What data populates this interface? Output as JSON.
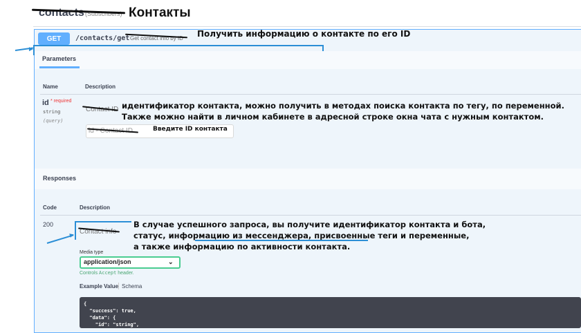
{
  "header": {
    "tag_title": "contacts",
    "tag_subtitle": "(Subscribers)",
    "tag_title_ru": "Контакты"
  },
  "operation": {
    "method": "GET",
    "path": "/contacts/get",
    "summary": "Get contact info by ID",
    "note": "Получить информацию о контакте по его ID"
  },
  "tabs": {
    "parameters": "Parameters"
  },
  "params_table": {
    "col_name": "Name",
    "col_description": "Description",
    "param": {
      "name": "id",
      "required_mark": "*",
      "required_label": "required",
      "type": "string",
      "in": "(query)",
      "description": "Contact ID",
      "input_placeholder": "id - Contact ID",
      "input_note": "Введите ID контакта",
      "note_line1": "идентификатор контакта, можно получить в методах поиска контакта по тегу, по переменной.",
      "note_line2": "Также можно найти в личном кабинете в адресной строке окна чата с нужным контактом."
    }
  },
  "responses": {
    "title": "Responses",
    "col_code": "Code",
    "col_description": "Description",
    "code": "200",
    "description": "Contact info",
    "note_line1": "В случае успешного запроса, вы получите идентификатор контакта и бота,",
    "note_line2": "статус, информацию из мессенджера, присвоенные теги и переменные,",
    "note_line3": "а также информацию по активности контакта.",
    "media_type_label": "Media type",
    "media_type_value": "application/json",
    "controls_prefix": "Controls ",
    "controls_code": "Accept",
    "controls_suffix": " header.",
    "example_tab": "Example Value",
    "schema_tab": "Schema",
    "code_lines": [
      "{",
      "  \"success\": true,",
      "  \"data\": {",
      "    \"id\": \"string\","
    ]
  },
  "colors": {
    "get_blue": "#61affe",
    "annotation_blue": "#2b8ed6",
    "media_green": "#49cc90",
    "code_bg": "#41444e"
  }
}
